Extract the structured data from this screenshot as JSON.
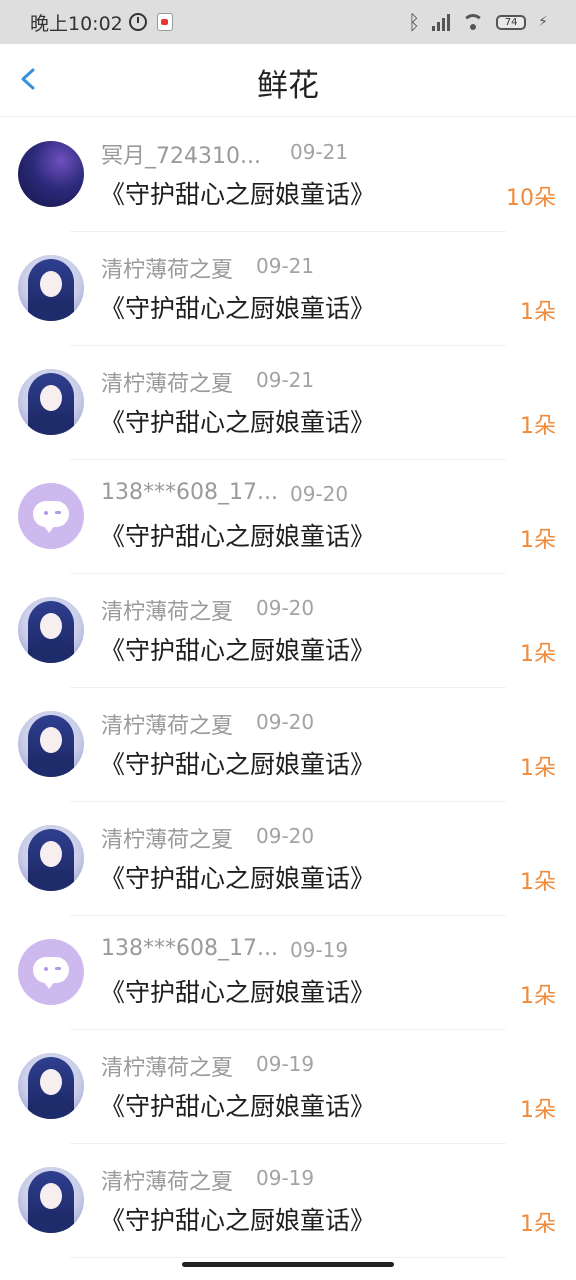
{
  "status_bar": {
    "time": "晚上10:02",
    "battery": "74"
  },
  "header": {
    "title": "鲜花"
  },
  "records": [
    {
      "user": "冥月_724310...",
      "date": "09-21",
      "book": "《守护甜心之厨娘童话》",
      "count": "10朵",
      "avatar": "galaxy"
    },
    {
      "user": "清柠薄荷之夏",
      "date": "09-21",
      "book": "《守护甜心之厨娘童话》",
      "count": "1朵",
      "avatar": "girl"
    },
    {
      "user": "清柠薄荷之夏",
      "date": "09-21",
      "book": "《守护甜心之厨娘童话》",
      "count": "1朵",
      "avatar": "girl"
    },
    {
      "user": "138***608_17...",
      "date": "09-20",
      "book": "《守护甜心之厨娘童话》",
      "count": "1朵",
      "avatar": "chat"
    },
    {
      "user": "清柠薄荷之夏",
      "date": "09-20",
      "book": "《守护甜心之厨娘童话》",
      "count": "1朵",
      "avatar": "girl"
    },
    {
      "user": "清柠薄荷之夏",
      "date": "09-20",
      "book": "《守护甜心之厨娘童话》",
      "count": "1朵",
      "avatar": "girl"
    },
    {
      "user": "清柠薄荷之夏",
      "date": "09-20",
      "book": "《守护甜心之厨娘童话》",
      "count": "1朵",
      "avatar": "girl"
    },
    {
      "user": "138***608_17...",
      "date": "09-19",
      "book": "《守护甜心之厨娘童话》",
      "count": "1朵",
      "avatar": "chat"
    },
    {
      "user": "清柠薄荷之夏",
      "date": "09-19",
      "book": "《守护甜心之厨娘童话》",
      "count": "1朵",
      "avatar": "girl"
    },
    {
      "user": "清柠薄荷之夏",
      "date": "09-19",
      "book": "《守护甜心之厨娘童话》",
      "count": "1朵",
      "avatar": "girl"
    }
  ],
  "colors": {
    "accent_back": "#3a8fd9",
    "count_orange": "#f08a3a"
  }
}
